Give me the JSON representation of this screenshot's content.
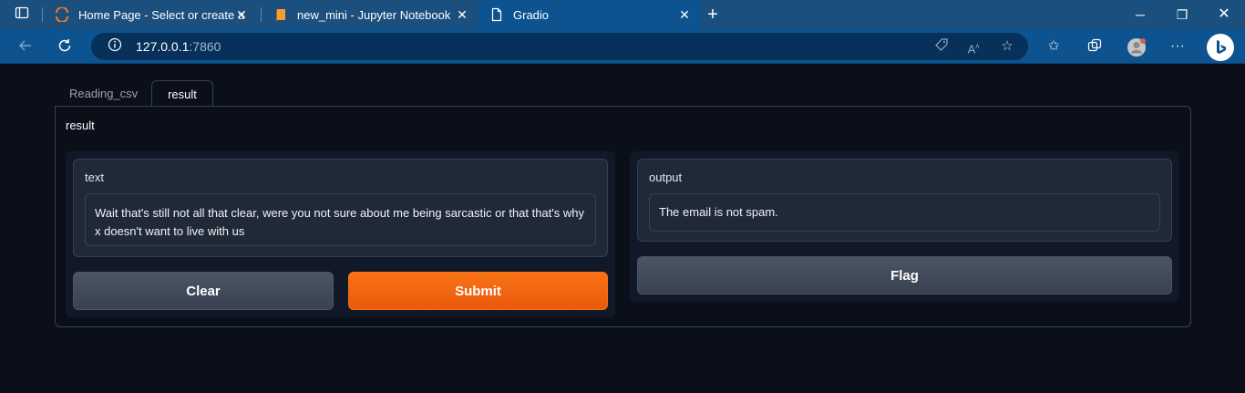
{
  "browser": {
    "tabs": [
      {
        "label": "Home Page - Select or create a n",
        "icon": "jupyter-icon"
      },
      {
        "label": "new_mini - Jupyter Notebook",
        "icon": "notebook-icon"
      },
      {
        "label": "Gradio",
        "icon": "page-icon"
      }
    ],
    "url_host": "127.0.0.1",
    "url_port": ":7860"
  },
  "app": {
    "tabs": [
      "Reading_csv",
      "result"
    ],
    "panel_title": "result",
    "input": {
      "label": "text",
      "value": "Wait that's still not all that clear, were you not sure about me being sarcastic or that that's why x doesn't want to live with us"
    },
    "output": {
      "label": "output",
      "value": "The email is not spam."
    },
    "buttons": {
      "clear": "Clear",
      "submit": "Submit",
      "flag": "Flag"
    },
    "colors": {
      "background": "#0b0f19",
      "primary": "#f97316",
      "secondary": "#4b5563"
    }
  }
}
